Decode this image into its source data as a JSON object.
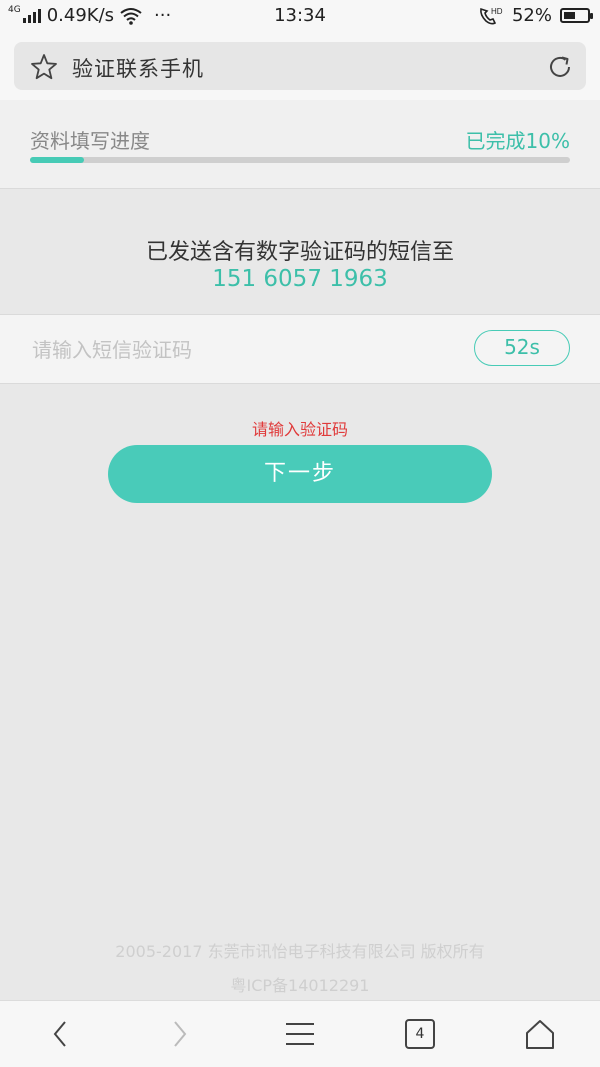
{
  "status": {
    "network": "4G",
    "speed": "0.49K/s",
    "more": "···",
    "time": "13:34",
    "hd": "HD",
    "battery": "52%",
    "battery_level": 0.52
  },
  "browser": {
    "title": "验证联系手机",
    "star_icon": "star-icon",
    "refresh_icon": "refresh-icon"
  },
  "progress": {
    "label": "资料填写进度",
    "status": "已完成10%",
    "value": 0.1,
    "color": "#47cbb6"
  },
  "sms": {
    "notice": "已发送含有数字验证码的短信至",
    "phone": "151 6057 1963"
  },
  "code": {
    "placeholder": "请输入短信验证码",
    "value": "",
    "countdown": "52s"
  },
  "error": "请输入验证码",
  "next_button": "下一步",
  "footer": {
    "copyright": "2005-2017 东莞市讯怡电子科技有限公司 版权所有",
    "icp": "粤ICP备14012291"
  },
  "nav": {
    "back_icon": "back-icon",
    "forward_icon": "forward-icon",
    "menu_icon": "menu-icon",
    "tab_count": "4",
    "home_icon": "home-icon"
  },
  "colors": {
    "accent": "#47cbb6",
    "error": "#e03a3a",
    "background": "#e8e8e8"
  }
}
